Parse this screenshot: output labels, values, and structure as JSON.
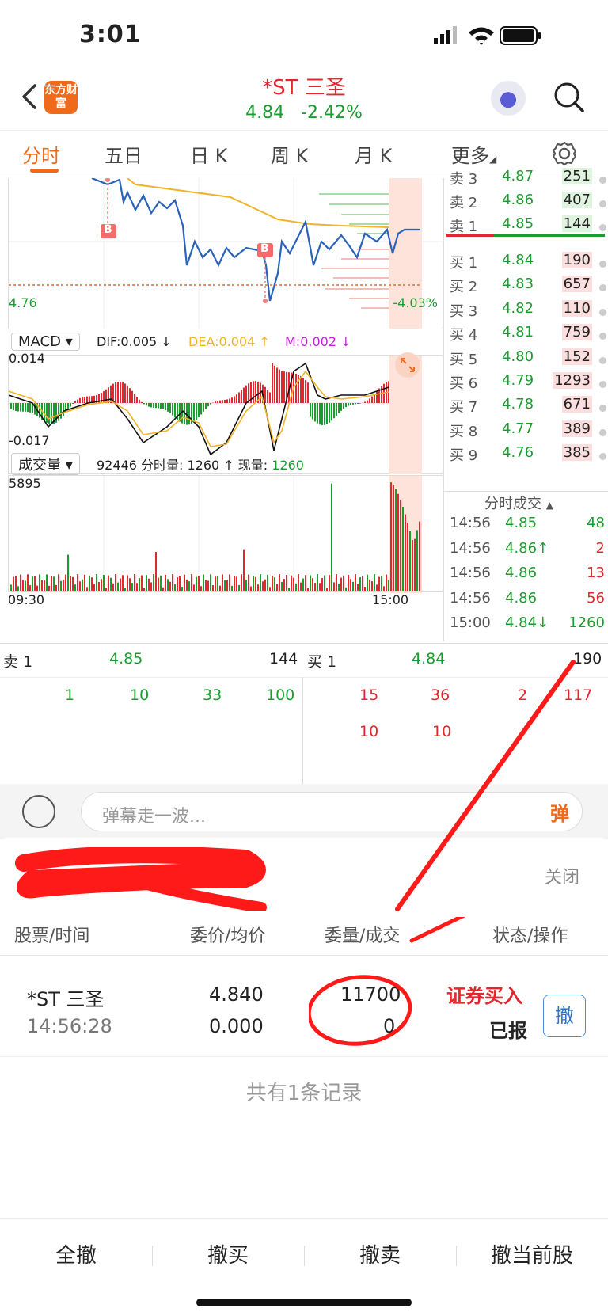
{
  "status_bar": {
    "time": "3:01"
  },
  "header": {
    "app_logo": "东方财富",
    "title": "*ST 三圣",
    "price": "4.84",
    "change": "-2.42%"
  },
  "tabs": [
    "分时",
    "五日",
    "日 K",
    "周 K",
    "月 K",
    "更多"
  ],
  "chart": {
    "low_price": "4.76",
    "low_change": "-4.03%",
    "buy_marker": "B",
    "macd_label": "MACD",
    "dif": "DIF:0.005 ↓",
    "dea": "DEA:0.004 ↑",
    "m": "M:0.002 ↓",
    "macd_max": "0.014",
    "macd_min": "-0.017",
    "volume_label": "成交量",
    "volume_info_prefix": "92446 分时量: 1260 ↑ 现量: ",
    "volume_now": "1260",
    "volume_max": "5895",
    "time_start": "09:30",
    "time_end": "15:00",
    "colors": {
      "price_line": "#2a62b8",
      "avg_line": "#f0b429",
      "up": "#e0282e",
      "down": "#1a9d2f"
    }
  },
  "order_book": {
    "sell": [
      {
        "label": "卖 3",
        "price": "4.87",
        "vol": "251"
      },
      {
        "label": "卖 2",
        "price": "4.86",
        "vol": "407"
      },
      {
        "label": "卖 1",
        "price": "4.85",
        "vol": "144"
      }
    ],
    "buy": [
      {
        "label": "买 1",
        "price": "4.84",
        "vol": "190"
      },
      {
        "label": "买 2",
        "price": "4.83",
        "vol": "657"
      },
      {
        "label": "买 3",
        "price": "4.82",
        "vol": "110"
      },
      {
        "label": "买 4",
        "price": "4.81",
        "vol": "759"
      },
      {
        "label": "买 5",
        "price": "4.80",
        "vol": "152"
      },
      {
        "label": "买 6",
        "price": "4.79",
        "vol": "1293"
      },
      {
        "label": "买 7",
        "price": "4.78",
        "vol": "671"
      },
      {
        "label": "买 8",
        "price": "4.77",
        "vol": "389"
      },
      {
        "label": "买 9",
        "price": "4.76",
        "vol": "385"
      }
    ],
    "ticks_title": "分时成交",
    "ticks": [
      {
        "time": "14:56",
        "price": "4.85",
        "vol": "48"
      },
      {
        "time": "14:56",
        "price": "4.86↑",
        "vol": "2"
      },
      {
        "time": "14:56",
        "price": "4.86",
        "vol": "13"
      },
      {
        "time": "14:56",
        "price": "4.86",
        "vol": "56"
      },
      {
        "time": "15:00",
        "price": "4.84↓",
        "vol": "1260"
      }
    ]
  },
  "quote_table": {
    "sell1_label": "卖 1",
    "sell1_price": "4.85",
    "sell1_vol": "144",
    "buy1_label": "买 1",
    "buy1_price": "4.84",
    "buy1_vol": "190",
    "sell_queue": [
      "1",
      "10",
      "33",
      "100"
    ],
    "buy_queue": [
      "15",
      "36",
      "2",
      "117",
      "10",
      "10"
    ]
  },
  "comment": {
    "placeholder": "弹幕走一波...",
    "danmu": "弹"
  },
  "order_sheet": {
    "close": "关闭",
    "headers": [
      "股票/时间",
      "委价/均价",
      "委量/成交",
      "状态/操作"
    ],
    "order": {
      "name": "*ST 三圣",
      "time": "14:56:28",
      "price": "4.840",
      "avg_price": "0.000",
      "qty": "11700",
      "filled": "0",
      "type": "证券买入",
      "status": "已报",
      "cancel": "撤"
    },
    "record_count": "共有1条记录"
  },
  "bottom_actions": [
    "全撤",
    "撤买",
    "撤卖",
    "撤当前股"
  ]
}
